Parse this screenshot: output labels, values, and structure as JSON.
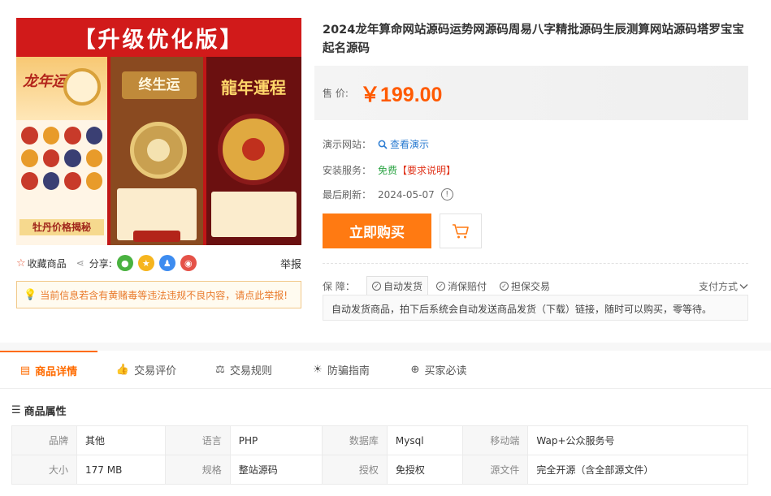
{
  "product": {
    "title": "2024龙年算命网站源码运势网源码周易八字精批源码生辰测算网站源码塔罗宝宝起名源码",
    "image": {
      "banner": "【升级优化版】",
      "panel1_title": "龙年运势",
      "panel1_footer": "牡丹价格揭秘",
      "panel2_title": "终生运",
      "panel3_title": "龍年運程"
    },
    "favorite_label": "收藏商品",
    "share_label": "分享:",
    "report_label": "举报",
    "warning_text": "当前信息若含有黄赌毒等违法违规不良内容，请点此举报!"
  },
  "price": {
    "label": "售  价:",
    "value": "￥199.00"
  },
  "info": {
    "demo_label": "演示网站：",
    "demo_link": "查看演示",
    "service_label": "安装服务：",
    "service_value": "免费",
    "service_requirement": "【要求说明】",
    "refresh_label": "最后刷新：",
    "refresh_date": "2024-05-07"
  },
  "actions": {
    "buy_label": "立即购买"
  },
  "guarantee": {
    "label": "保  障：",
    "items": [
      "自动发货",
      "消保赔付",
      "担保交易"
    ],
    "pay_method": "支付方式",
    "description": "自动发货商品，拍下后系统会自动发送商品发货（下载）链接，随时可以购买，零等待。"
  },
  "tabs": [
    {
      "label": "商品详情",
      "icon": "shop-icon"
    },
    {
      "label": "交易评价",
      "icon": "thumbs-up-icon"
    },
    {
      "label": "交易规则",
      "icon": "scale-icon"
    },
    {
      "label": "防骗指南",
      "icon": "bulb-icon"
    },
    {
      "label": "买家必读",
      "icon": "circle-plus-icon"
    }
  ],
  "attributes": {
    "heading": "商品属性",
    "rows": [
      [
        {
          "k": "品牌",
          "v": "其他"
        },
        {
          "k": "语言",
          "v": "PHP"
        },
        {
          "k": "数据库",
          "v": "Mysql"
        },
        {
          "k": "移动端",
          "v": "Wap+公众服务号"
        }
      ],
      [
        {
          "k": "大小",
          "v": "177 MB"
        },
        {
          "k": "规格",
          "v": "整站源码"
        },
        {
          "k": "授权",
          "v": "免授权"
        },
        {
          "k": "源文件",
          "v": "完全开源（含全部源文件）"
        }
      ]
    ]
  },
  "colors": {
    "accent": "#ff7a12",
    "price": "#ff5a00",
    "link": "#2a7bd1",
    "free": "#2da445"
  }
}
